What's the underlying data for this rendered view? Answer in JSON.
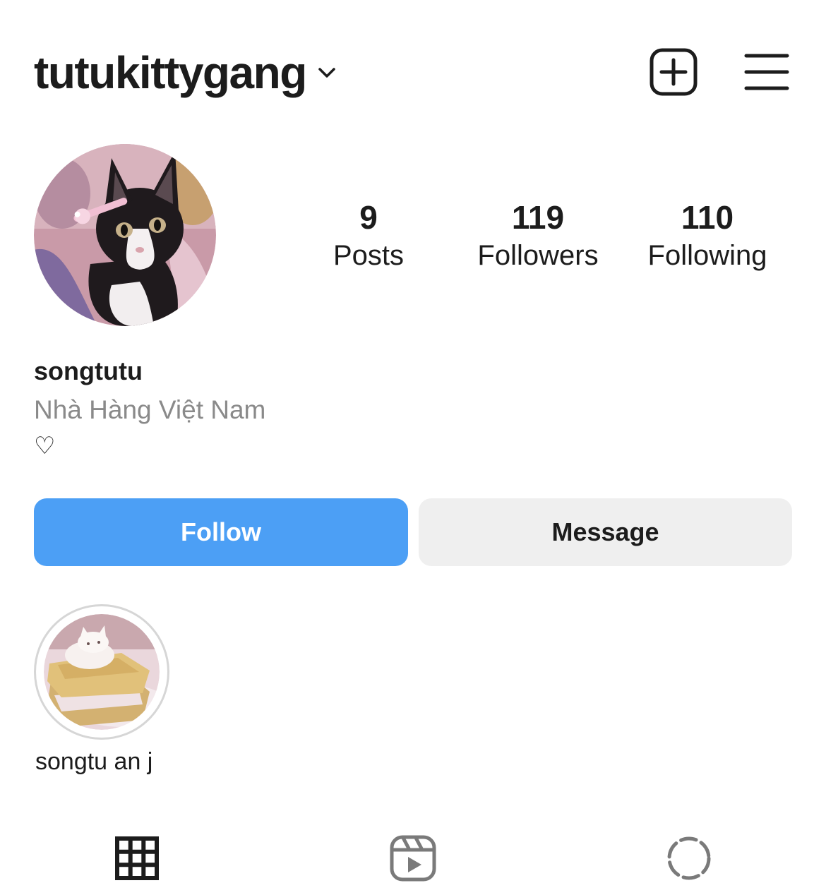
{
  "header": {
    "username": "tutukittygang",
    "icons": {
      "switch_account": "chevron-down-icon",
      "new_post": "plus-square-icon",
      "menu": "hamburger-menu-icon"
    }
  },
  "profile": {
    "avatar": "cat-avatar-photo",
    "stats": [
      {
        "value": "9",
        "label": "Posts"
      },
      {
        "value": "119",
        "label": "Followers"
      },
      {
        "value": "110",
        "label": "Following"
      }
    ],
    "display_name": "songtutu",
    "category": "Nhà Hàng Việt Nam",
    "bio": "♡"
  },
  "actions": {
    "follow_label": "Follow",
    "message_label": "Message"
  },
  "highlights": [
    {
      "label": "songtu an j",
      "image": "cake-highlight-photo"
    }
  ],
  "tabs": [
    {
      "icon": "grid-icon",
      "active": true
    },
    {
      "icon": "reels-icon",
      "active": false
    },
    {
      "icon": "tagged-icon",
      "active": false
    }
  ],
  "colors": {
    "accent": "#4c9ff5",
    "secondary_button": "#efefef",
    "text": "#1c1c1c",
    "muted_text": "#8a8a8a"
  }
}
